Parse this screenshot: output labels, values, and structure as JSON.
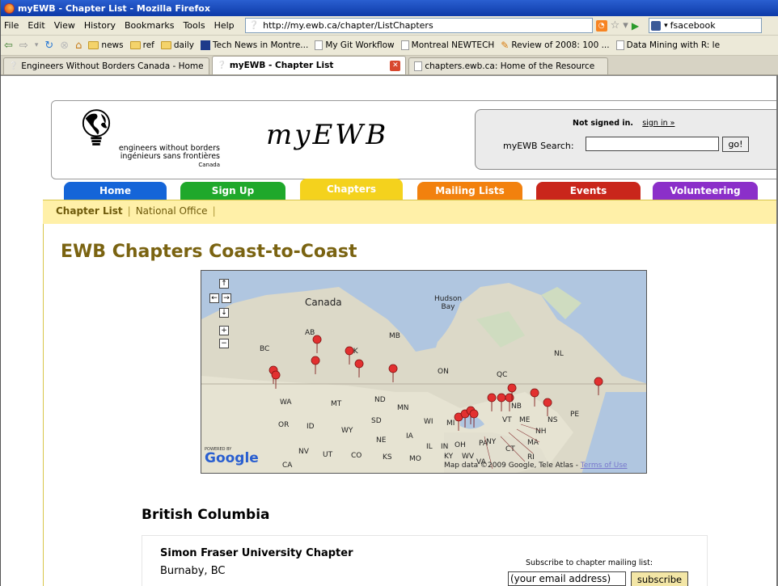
{
  "window": {
    "title": "myEWB - Chapter List - Mozilla Firefox"
  },
  "menubar": {
    "items": [
      "File",
      "Edit",
      "View",
      "History",
      "Bookmarks",
      "Tools",
      "Help"
    ],
    "url": "http://my.ewb.ca/chapter/ListChapters",
    "search_value": "fsacebook"
  },
  "bookmarks": {
    "items": [
      {
        "label": "news",
        "icon": "folder-icon"
      },
      {
        "label": "ref",
        "icon": "folder-icon"
      },
      {
        "label": "daily",
        "icon": "folder-icon"
      },
      {
        "label": "Tech News in Montre...",
        "icon": "technews-icon"
      },
      {
        "label": "My Git Workflow",
        "icon": "page-icon"
      },
      {
        "label": "Montreal NEWTECH",
        "icon": "page-icon"
      },
      {
        "label": "Review of 2008: 100 ...",
        "icon": "pencil-icon"
      },
      {
        "label": "Data Mining with R: le",
        "icon": "page-icon"
      }
    ]
  },
  "tabs": [
    {
      "label": "Engineers Without Borders Canada - Home",
      "active": false
    },
    {
      "label": "myEWB - Chapter List",
      "active": true
    },
    {
      "label": "chapters.ewb.ca: Home of the Resource",
      "active": false
    }
  ],
  "header": {
    "logo_line1": "engineers without borders",
    "logo_line2": "ingénieurs sans frontières",
    "logo_line3": "Canada",
    "site_title": "myEWB",
    "signin_status": "Not signed in.",
    "signin_link": "sign in »",
    "search_label": "myEWB Search:",
    "search_button": "go!"
  },
  "nav": {
    "tabs": [
      {
        "label": "Home",
        "color": "#1565d8"
      },
      {
        "label": "Sign Up",
        "color": "#1fa82b"
      },
      {
        "label": "Chapters",
        "color": "#f4d21d"
      },
      {
        "label": "Mailing Lists",
        "color": "#f2810e"
      },
      {
        "label": "Events",
        "color": "#c9261b"
      },
      {
        "label": "Volunteering",
        "color": "#8b2fc9"
      }
    ],
    "subnav": [
      "Chapter List",
      "National Office"
    ]
  },
  "page": {
    "heading": "EWB Chapters Coast-to-Coast",
    "section_heading": "British Columbia"
  },
  "map": {
    "labels": [
      "Canada",
      "Hudson Bay",
      "AB",
      "MB",
      "BC",
      "SK",
      "ON",
      "QC",
      "NL",
      "NB",
      "NS",
      "PE",
      "WA",
      "MT",
      "ND",
      "MN",
      "OR",
      "ID",
      "SD",
      "WI",
      "WY",
      "MI",
      "NY",
      "VT",
      "ME",
      "NH",
      "MA",
      "NE",
      "IA",
      "CT",
      "RI",
      "NV",
      "UT",
      "CO",
      "KS",
      "MO",
      "IL",
      "IN",
      "OH",
      "PA",
      "KY",
      "WV",
      "VA",
      "CA"
    ],
    "powered_by": "POWERED BY",
    "google": "Google",
    "attribution": "Map data ©2009 Google, Tele Atlas -",
    "terms": "Terms of Use"
  },
  "chapter": {
    "name": "Simon Fraser University Chapter",
    "location": "Burnaby, BC",
    "subscribe_label": "Subscribe to chapter mailing list:",
    "email_placeholder": "(your email address)",
    "subscribe_button": "subscribe"
  }
}
